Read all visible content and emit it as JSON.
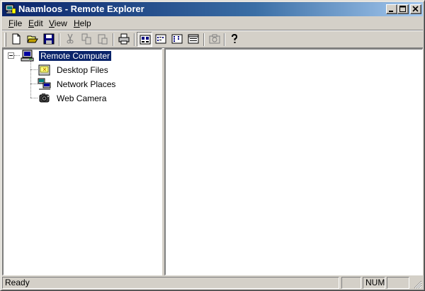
{
  "window": {
    "title": "Naamloos - Remote Explorer",
    "title_icon": "remote-explorer-app-icon",
    "controls": [
      "minimize-icon",
      "maximize-icon",
      "close-icon"
    ]
  },
  "menu": {
    "items": [
      {
        "label": "File"
      },
      {
        "label": "Edit"
      },
      {
        "label": "View"
      },
      {
        "label": "Help"
      }
    ]
  },
  "toolbar": {
    "buttons": [
      {
        "icon": "new-document-icon"
      },
      {
        "icon": "open-folder-icon"
      },
      {
        "icon": "save-disk-icon"
      },
      {
        "icon": "cut-scissors-icon"
      },
      {
        "icon": "copy-icon"
      },
      {
        "icon": "paste-icon"
      },
      {
        "icon": "print-icon"
      },
      {
        "icon": "view-large-icons-icon",
        "pressed": true
      },
      {
        "icon": "view-small-icons-icon"
      },
      {
        "icon": "view-list-icon"
      },
      {
        "icon": "view-details-icon"
      },
      {
        "icon": "camera-capture-icon"
      },
      {
        "icon": "help-question-icon"
      }
    ]
  },
  "tree": {
    "root": {
      "label": "Remote Computer",
      "icon": "computer-icon",
      "expanded": true,
      "selected": true
    },
    "children": [
      {
        "label": "Desktop Files",
        "icon": "desktop-files-icon"
      },
      {
        "label": "Network Places",
        "icon": "network-places-icon"
      },
      {
        "label": "Web Camera",
        "icon": "web-camera-icon"
      }
    ]
  },
  "status": {
    "text": "Ready",
    "panels": [
      "",
      "NUM",
      ""
    ]
  },
  "colors": {
    "title_active": "#0a246a",
    "title_gradient_end": "#a6caf0",
    "selection": "#0a246a",
    "face": "#d4d0c8"
  }
}
